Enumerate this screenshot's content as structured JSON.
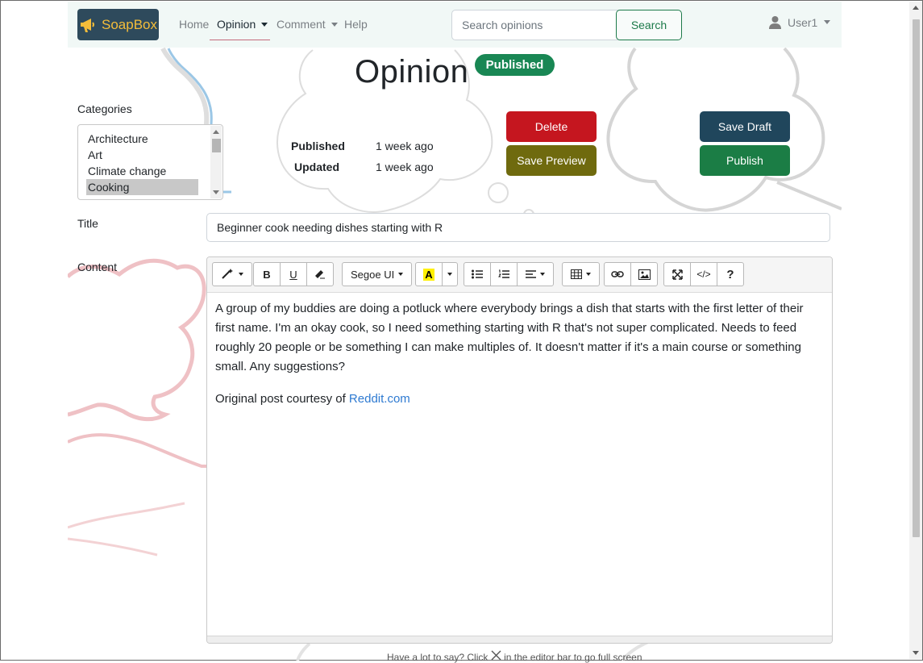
{
  "brand": {
    "name": "SoapBox",
    "icon": "megaphone-icon",
    "color": "#f4bd3a"
  },
  "nav": {
    "items": [
      {
        "label": "Home",
        "active": false
      },
      {
        "label": "Opinion",
        "active": true,
        "dropdown": true
      },
      {
        "label": "Comment",
        "active": false,
        "dropdown": true
      },
      {
        "label": "Help",
        "active": false
      }
    ],
    "search_placeholder": "Search opinions",
    "search_button": "Search",
    "user": "User1"
  },
  "page": {
    "title": "Opinion",
    "status_badge": "Published",
    "meta": {
      "published_label": "Published",
      "published_value": "1 week ago",
      "updated_label": "Updated",
      "updated_value": "1 week ago"
    },
    "buttons": {
      "delete": "Delete",
      "save_preview": "Save Preview",
      "save_draft": "Save Draft",
      "publish": "Publish"
    }
  },
  "categories": {
    "label": "Categories",
    "items": [
      "Architecture",
      "Art",
      "Climate change",
      "Cooking"
    ],
    "selected": "Cooking"
  },
  "form": {
    "title_label": "Title",
    "title_value": "Beginner cook needing dishes starting with R",
    "content_label": "Content"
  },
  "editor": {
    "font_name": "Segoe UI",
    "paragraphs": [
      "A group of my buddies are doing a potluck where everybody brings a dish that starts with the first letter of their first name. I'm an okay cook, so I need something starting with R that's not super complicated. Needs to feed roughly 20 people or be something I can make multiples of. It doesn't matter if it's a main course or something small. Any suggestions?"
    ],
    "credit_prefix": "Original post courtesy of ",
    "credit_link": "Reddit.com"
  },
  "footer": {
    "hint_before": "Have a lot to say? Click",
    "hint_after": "in the editor bar to go full screen"
  },
  "colors": {
    "delete": "#c5161f",
    "save_preview": "#6f6a0e",
    "save_draft": "#20465c",
    "publish": "#1b7d45",
    "badge": "#198754"
  }
}
